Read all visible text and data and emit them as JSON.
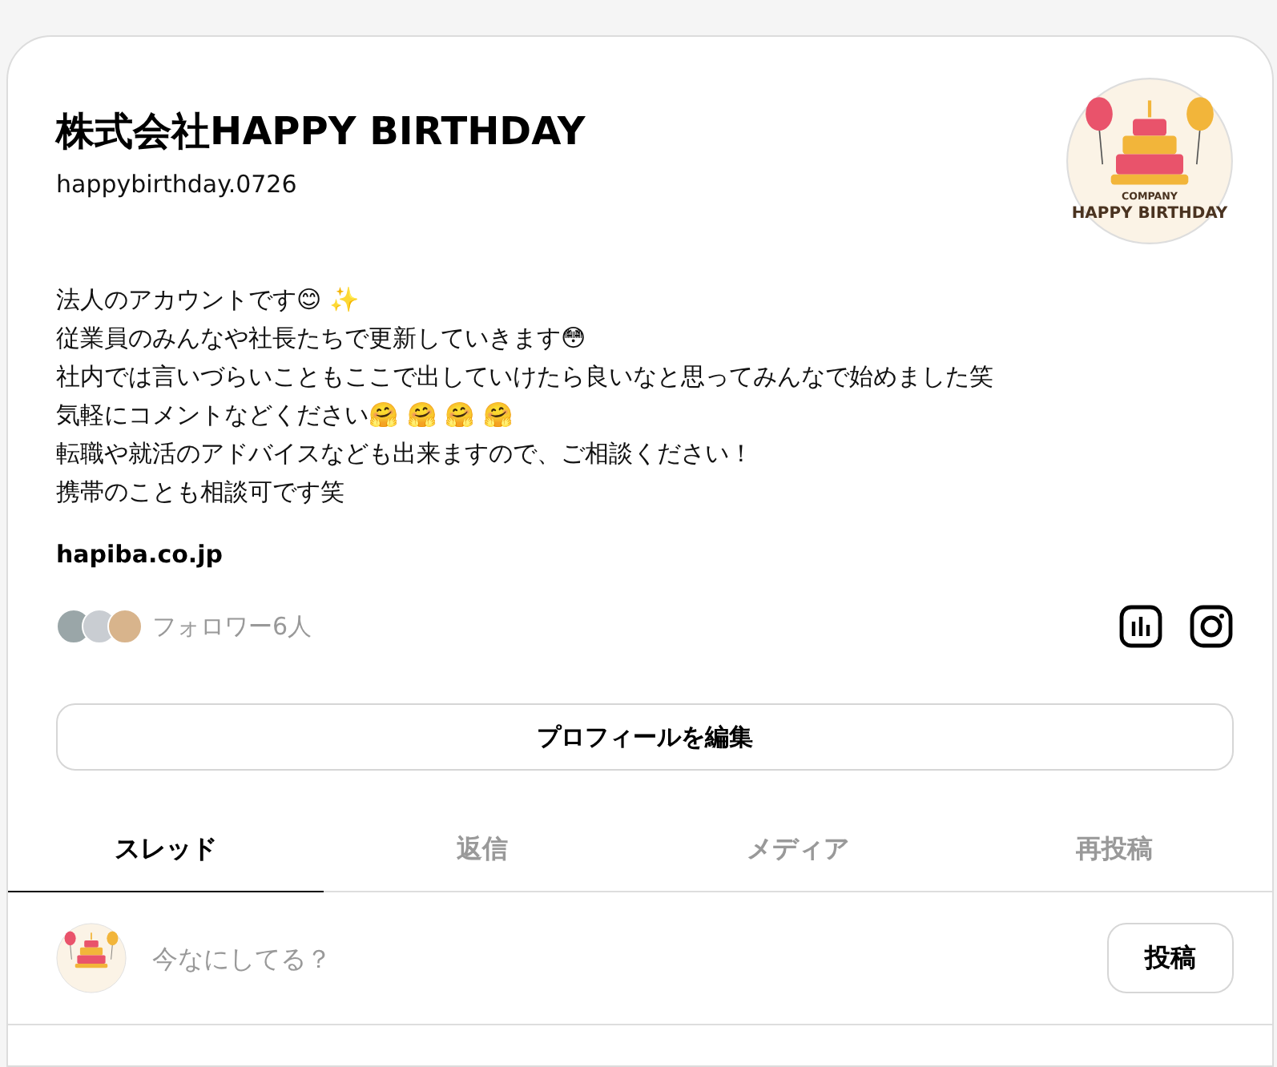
{
  "profile": {
    "name": "株式会社HAPPY BIRTHDAY",
    "handle": "happybirthday.0726",
    "avatar_logo": {
      "small_line": "COMPANY",
      "big_line": "HAPPY BIRTHDAY"
    }
  },
  "bio": [
    "法人のアカウントです😊 ✨",
    "従業員のみんなや社長たちで更新していきます😳",
    "社内では言いづらいこともここで出していけたら良いなと思ってみんなで始めました笑",
    "気軽にコメントなどください🤗 🤗 🤗 🤗",
    "転職や就活のアドバイスなども出来ますので、ご相談ください！",
    "携帯のことも相談可です笑"
  ],
  "link": "hapiba.co.jp",
  "followers": {
    "label": "フォロワー6人"
  },
  "edit_button": "プロフィールを編集",
  "tabs": [
    {
      "label": "スレッド",
      "selected": true
    },
    {
      "label": "返信",
      "selected": false
    },
    {
      "label": "メディア",
      "selected": false
    },
    {
      "label": "再投稿",
      "selected": false
    }
  ],
  "composer": {
    "placeholder": "今なにしてる？",
    "post_button": "投稿"
  }
}
